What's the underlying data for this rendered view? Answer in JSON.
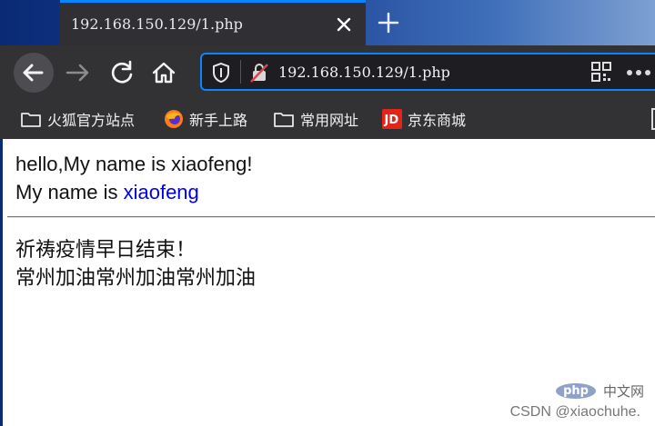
{
  "browser": {
    "tab": {
      "title": "192.168.150.129/1.php"
    },
    "url": "192.168.150.129/1.php"
  },
  "bookmarks": [
    {
      "label": "火狐官方站点",
      "icon": "folder-icon"
    },
    {
      "label": "新手上路",
      "icon": "firefox-icon"
    },
    {
      "label": "常用网址",
      "icon": "folder-icon"
    },
    {
      "label": "京东商城",
      "icon": "jd-icon"
    }
  ],
  "page": {
    "line1": "hello,My name is xiaofeng!",
    "line2_prefix": "My name is ",
    "line2_name": "xiaofeng",
    "line3": "祈祷疫情早日结束！",
    "line4": "常州加油常州加油常州加油"
  },
  "watermark": {
    "text": "CSDN @xiaochuhe.",
    "php_logo": "php",
    "php_cn": "中文网"
  },
  "colors": {
    "accent": "#0a84ff",
    "link": "#0000ee",
    "toolbar": "#323234"
  }
}
